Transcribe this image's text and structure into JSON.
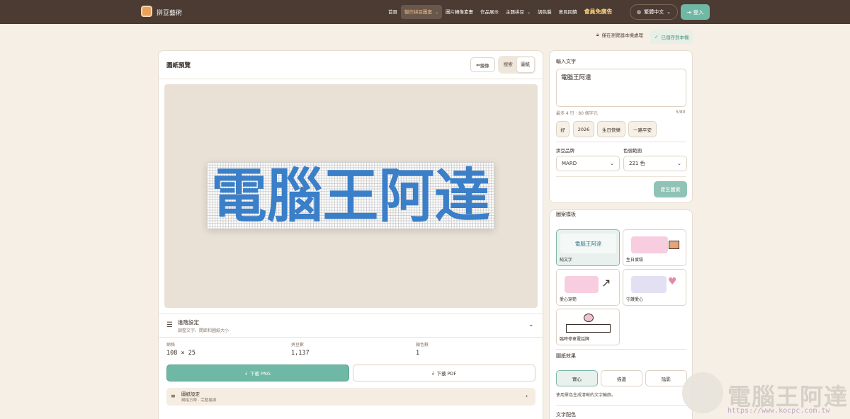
{
  "nav": {
    "brand": "拼豆藝術",
    "items": [
      {
        "label": "首頁",
        "active": false
      },
      {
        "label": "製作拼豆圖案",
        "active": true,
        "dropdown": true
      },
      {
        "label": "圖片轉像素畫",
        "active": false
      },
      {
        "label": "作品展示",
        "active": false
      },
      {
        "label": "主題拼豆",
        "active": false,
        "dropdown": true
      },
      {
        "label": "調色盤",
        "active": false
      },
      {
        "label": "意見回饋",
        "active": false
      }
    ],
    "ad_free": "會員免廣告",
    "language": "繁體中文",
    "login": "登入"
  },
  "status": {
    "local": "僅在瀏覽器本機處理",
    "saved": "已儲存到本機"
  },
  "preview": {
    "title": "圖紙預覽",
    "mirror": "鏡像",
    "mode_pixel": "搜索",
    "mode_sheet": "圖紙",
    "pixel_text": "電腦王阿達",
    "pixel_color": "#3a7fc8"
  },
  "advanced": {
    "title": "進階設定",
    "subtitle": "調整文字、間距和圖紙大小"
  },
  "stats": {
    "grid_label": "網格",
    "grid_value": "108 × 25",
    "beads_label": "拼豆數",
    "beads_value": "1,137",
    "colors_label": "顏色數",
    "colors_value": "1"
  },
  "downloads": {
    "png": "下載 PNG",
    "pdf": "下載 PDF"
  },
  "sheet_settings": {
    "title": "圖紙設定",
    "subtitle": "網格方陣 · 完整格線"
  },
  "input": {
    "label": "輸入文字",
    "value": "電腦王阿達",
    "hint": "最多 4 行 · 80 個字元",
    "count": "5/80",
    "chips": [
      "好",
      "2026",
      "生日快樂",
      "一路平安"
    ]
  },
  "brand_select": {
    "label": "拼豆品牌",
    "value": "MARD"
  },
  "color_select": {
    "label": "色號範圍",
    "value": "221 色"
  },
  "generate": "產生圖案",
  "templates": {
    "label": "圖案模板",
    "items": [
      {
        "label": "純文字",
        "preview": "電腦王阿達",
        "selected": true
      },
      {
        "label": "生日蛋糕",
        "selected": false
      },
      {
        "label": "愛心穿箭",
        "selected": false
      },
      {
        "label": "守護愛心",
        "selected": false
      },
      {
        "label": "臨時停車電話牌",
        "selected": false
      }
    ]
  },
  "effects": {
    "label": "圖紙效果",
    "options": [
      {
        "label": "實心",
        "selected": true
      },
      {
        "label": "描邊",
        "selected": false
      },
      {
        "label": "陰影",
        "selected": false
      }
    ],
    "hint": "使用單色生成清晰的文字輪廓。"
  },
  "text_color_label": "文字配色",
  "watermark": {
    "text": "電腦王阿達",
    "url": "https://www.kocpc.com.tw"
  }
}
